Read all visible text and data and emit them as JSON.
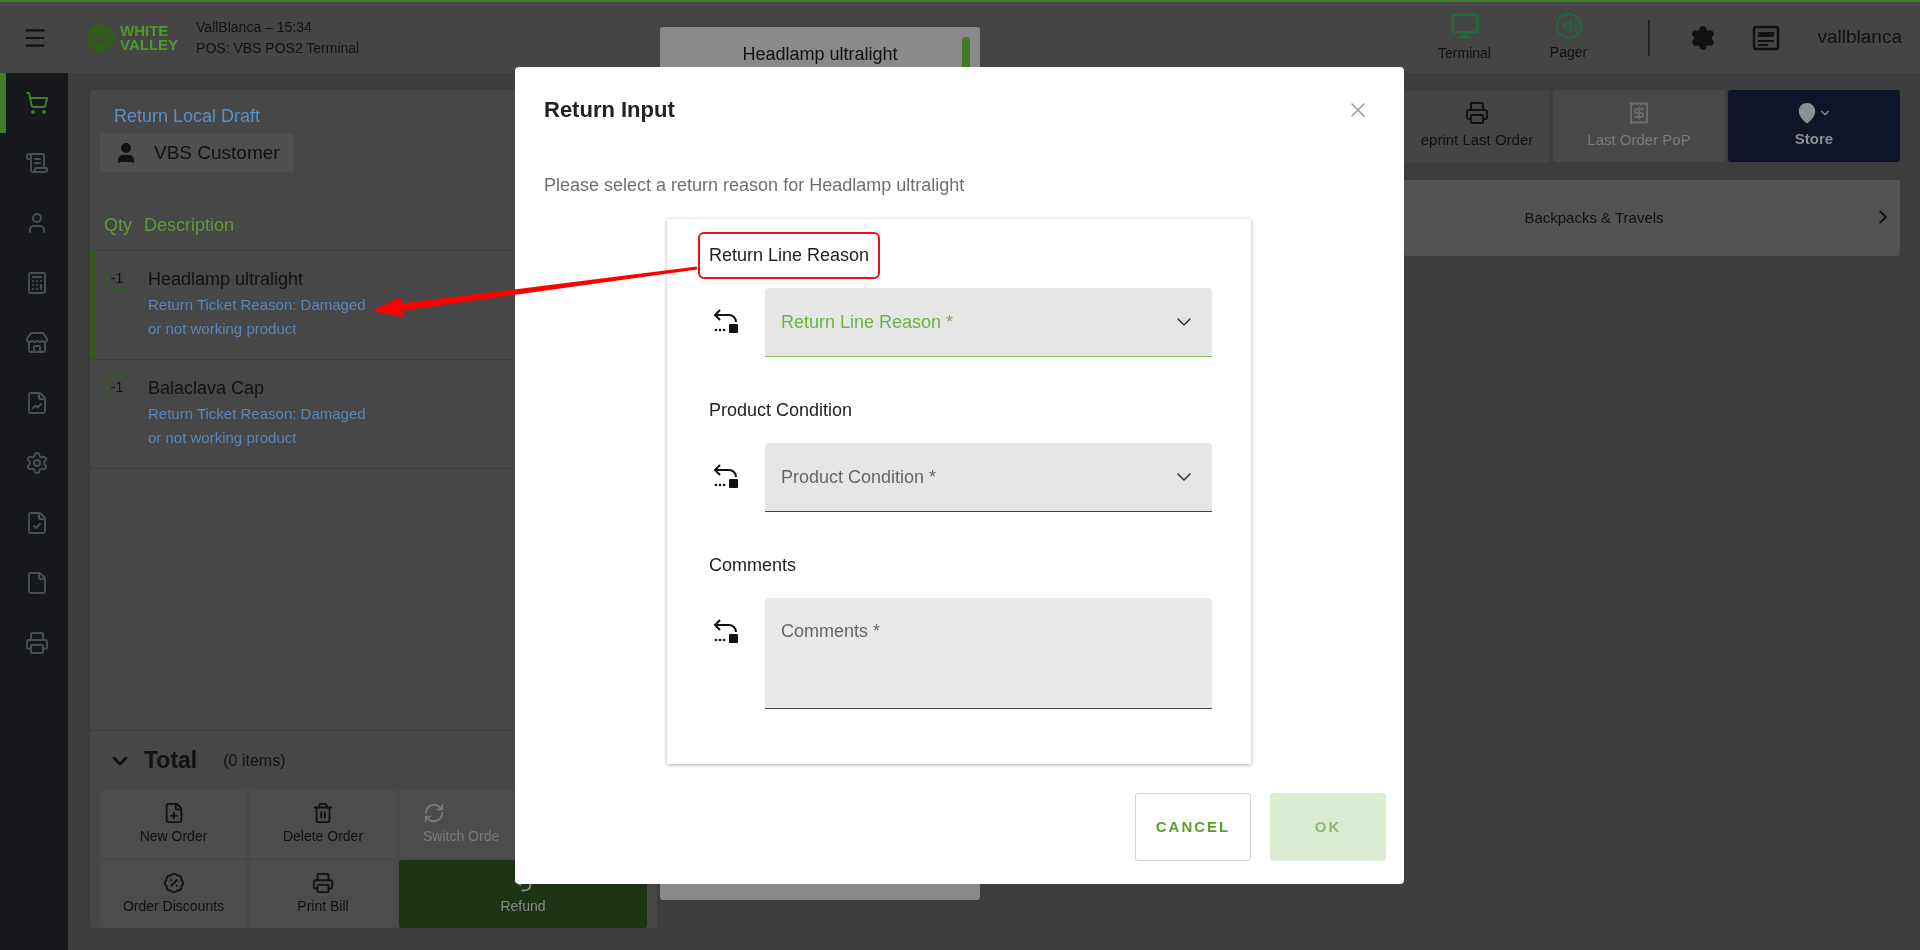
{
  "top_bar": {
    "brand": {
      "line1": "WHITE",
      "line2": "VALLEY"
    },
    "store": "VallBlanca – 15:34",
    "terminal": "POS: VBS POS2 Terminal",
    "actions": [
      {
        "label": "Terminal",
        "kind": "terminal"
      },
      {
        "label": "Pager",
        "kind": "pager"
      }
    ],
    "user": "vallblanca"
  },
  "sidebar": {
    "items": [
      {
        "kind": "cart",
        "selected": true
      },
      {
        "kind": "receipt",
        "selected": false
      },
      {
        "kind": "person",
        "selected": false
      },
      {
        "kind": "register",
        "selected": false
      },
      {
        "kind": "store",
        "selected": false
      },
      {
        "kind": "report",
        "selected": false
      },
      {
        "kind": "settings",
        "selected": false
      },
      {
        "kind": "check",
        "selected": false
      },
      {
        "kind": "file",
        "selected": false
      },
      {
        "kind": "printer",
        "selected": false
      }
    ]
  },
  "ticket": {
    "title": "Return Local Draft",
    "customer": "VBS Customer",
    "columns": [
      "Qty",
      "Description"
    ],
    "lines": [
      {
        "qty": "-1",
        "name": "Headlamp ultralight",
        "reason": "Return Ticket Reason: Damaged or not working product",
        "selected": true
      },
      {
        "qty": "-1",
        "name": "Balaclava Cap",
        "reason": "Return Ticket Reason: Damaged or not working product",
        "selected": false
      }
    ],
    "total": {
      "label": "Total",
      "count": "(0 items)",
      "expanded": true
    },
    "buttons": [
      {
        "label": "New Order",
        "kind": "new",
        "disabled": false
      },
      {
        "label": "Delete Order",
        "kind": "delete",
        "disabled": false
      },
      {
        "label": "Switch Orde",
        "kind": "switch",
        "disabled": true
      },
      {
        "label": "Order Discounts",
        "kind": "discount",
        "disabled": false
      },
      {
        "label": "Print Bill",
        "kind": "print",
        "disabled": false
      },
      {
        "label": "Refund",
        "kind": "refund",
        "disabled": false
      }
    ]
  },
  "product_card": {
    "title": "Headlamp ultralight"
  },
  "toolbar": [
    {
      "label": "eprint Last Order",
      "kind": "reprint",
      "disabled": false
    },
    {
      "label": "Last Order PoP",
      "kind": "pop",
      "disabled": true
    },
    {
      "label": "Store",
      "kind": "store",
      "disabled": false
    }
  ],
  "category": {
    "label": "Backpacks & Travels"
  },
  "dialog": {
    "title": "Return Input",
    "message": "Please select a return reason for Headlamp ultralight",
    "sections": [
      {
        "label": "Return Line Reason",
        "highlighted": true,
        "field": {
          "kind": "select",
          "placeholder": "Return Line Reason *",
          "focused": true
        }
      },
      {
        "label": "Product Condition",
        "highlighted": false,
        "field": {
          "kind": "select",
          "placeholder": "Product Condition *",
          "focused": false
        }
      },
      {
        "label": "Comments",
        "highlighted": false,
        "field": {
          "kind": "textarea",
          "placeholder": "Comments *",
          "focused": false
        }
      }
    ],
    "buttons": [
      {
        "label": "CANCEL",
        "kind": "cancel",
        "disabled": false
      },
      {
        "label": "OK",
        "kind": "ok",
        "disabled": true
      }
    ]
  }
}
